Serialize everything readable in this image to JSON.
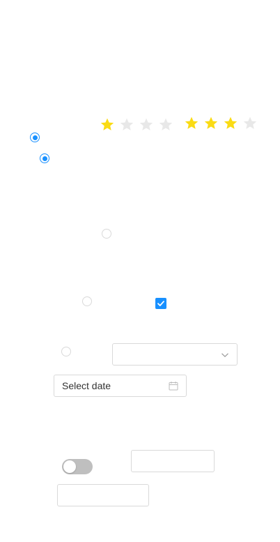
{
  "colors": {
    "accent": "#1890ff",
    "star_on": "#fadb14",
    "star_off": "#e8e8e8",
    "border": "#d9d9d9",
    "toggle_off": "#bfbfbf"
  },
  "ratings": [
    {
      "value": 1,
      "max": 4
    },
    {
      "value": 3,
      "max": 4
    }
  ],
  "radios": [
    {
      "checked": true
    },
    {
      "checked": true
    },
    {
      "checked": false
    },
    {
      "checked": false
    },
    {
      "checked": false
    }
  ],
  "checkbox": {
    "checked": true
  },
  "select": {
    "value": "",
    "icon": "chevron-down-icon"
  },
  "date_picker": {
    "placeholder": "Select date",
    "icon": "calendar-icon"
  },
  "toggle": {
    "on": false
  },
  "text_inputs": [
    {
      "value": ""
    },
    {
      "value": ""
    }
  ]
}
